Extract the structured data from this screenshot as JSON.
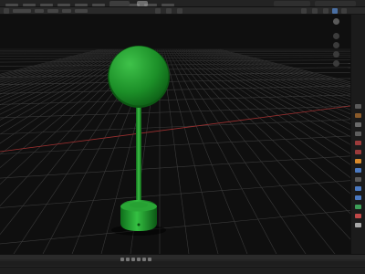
{
  "window": {
    "menu_items": [
      "",
      "",
      "",
      "",
      "",
      "",
      "",
      "",
      "",
      ""
    ],
    "workspace_tabs": [
      "",
      "",
      "",
      ""
    ]
  },
  "viewport": {
    "header_label": "",
    "grid_visible": true,
    "background": "#0f0f0f"
  },
  "scene": {
    "sign": {
      "text_lines": [
        "",
        "",
        "",
        "",
        "",
        ""
      ],
      "face_color": "#1f9a2d",
      "post_color": "#1d8a27",
      "base_color": "#23a12f",
      "text_color": "#e6ffe6"
    }
  },
  "timeline": {
    "frame_label": ""
  },
  "status_bar": {
    "text": ""
  },
  "colors": {
    "grid": "#3a3a3a",
    "axis_red": "#9b3030",
    "axis_green": "#5e9b2f",
    "ui_bg": "#1d1d1d"
  }
}
